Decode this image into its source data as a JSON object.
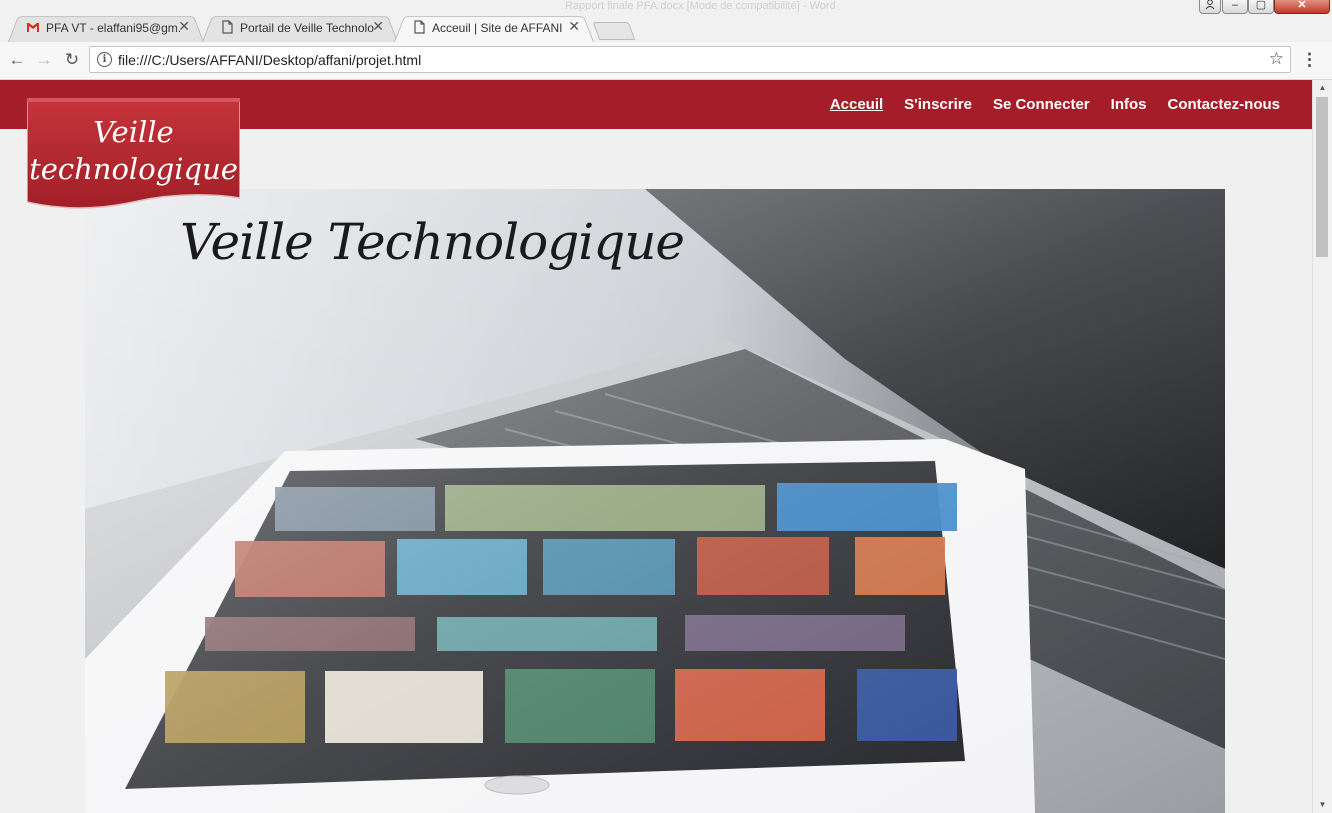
{
  "browser": {
    "background_window_title": "Rapport finale PFA.docx [Mode de compatibilité] - Word",
    "tabs": [
      {
        "label": "PFA VT - elaffani95@gm...",
        "icon": "gmail-icon",
        "active": false
      },
      {
        "label": "Portail de Veille Technolo...",
        "icon": "page-icon",
        "active": false
      },
      {
        "label": "Acceuil | Site de AFFANI",
        "icon": "page-icon",
        "active": true
      }
    ],
    "url": "file:///C:/Users/AFFANI/Desktop/affani/projet.html",
    "window_controls": {
      "minimize": "–",
      "maximize": "▢",
      "close": "✕"
    }
  },
  "site": {
    "logo_text_line1": "Veille",
    "logo_text_line2": "technologique",
    "nav": [
      {
        "label": "Acceuil",
        "active": true
      },
      {
        "label": "S'inscrire",
        "active": false
      },
      {
        "label": "Se Connecter",
        "active": false
      },
      {
        "label": "Infos",
        "active": false
      },
      {
        "label": "Contactez-nous",
        "active": false
      }
    ],
    "hero_title": "Veille Technologique"
  },
  "colors": {
    "header": "#a61d2a",
    "logo": "#b5262f",
    "page_bg": "#f0f0f0"
  }
}
